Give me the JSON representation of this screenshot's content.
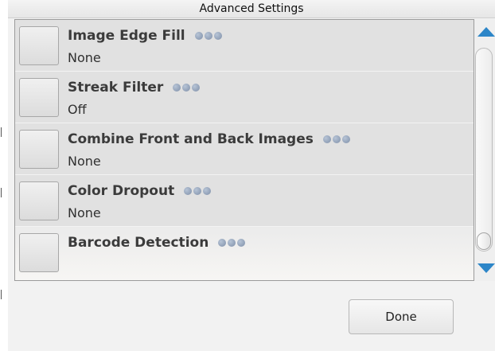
{
  "window": {
    "title": "Advanced Settings"
  },
  "settings": [
    {
      "title": "Image Edge Fill",
      "value": "None",
      "checked": false
    },
    {
      "title": "Streak Filter",
      "value": "Off",
      "checked": false
    },
    {
      "title": "Combine Front and Back Images",
      "value": "None",
      "checked": false
    },
    {
      "title": "Color Dropout",
      "value": "None",
      "checked": false
    },
    {
      "title": "Barcode Detection",
      "value": "",
      "checked": false
    }
  ],
  "scrollbar": {
    "position_fraction": 1.0,
    "arrow_color": "#2d86c8"
  },
  "footer": {
    "done_label": "Done"
  },
  "icons": {
    "more": "more-options-dots-icon",
    "scroll_up": "scroll-up-arrow-icon",
    "scroll_down": "scroll-down-arrow-icon"
  }
}
